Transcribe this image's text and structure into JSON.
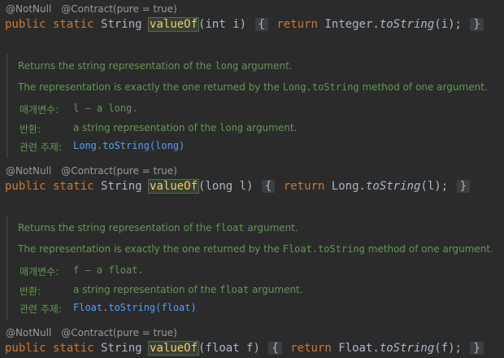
{
  "blocks": [
    {
      "annotations": [
        "@NotNull",
        "@Contract(pure = true)"
      ],
      "code": {
        "modifiers": "public static",
        "return_type": "String",
        "method": "valueOf",
        "param": "(int i)",
        "fold_open": "{",
        "body_kw": "return",
        "body_call": "Integer.",
        "body_method": "toString",
        "body_args": "(i);",
        "fold_close": "}"
      }
    },
    {
      "doc": {
        "line1_pre": "Returns the string representation of the ",
        "line1_code": "long",
        "line1_post": " argument.",
        "line2_pre": "The representation is exactly the one returned by the ",
        "line2_code": "Long.toString",
        "line2_post": " method of one argument.",
        "param_label": "매개변수:",
        "param_value": "l – a long.",
        "return_label": "반환:",
        "return_pre": "a string representation of the ",
        "return_code": "long",
        "return_post": " argument.",
        "see_label": "관련 주제:",
        "see_link": "Long.toString(long)"
      },
      "annotations": [
        "@NotNull",
        "@Contract(pure = true)"
      ],
      "code": {
        "modifiers": "public static",
        "return_type": "String",
        "method": "valueOf",
        "param": "(long l)",
        "fold_open": "{",
        "body_kw": "return",
        "body_call": "Long.",
        "body_method": "toString",
        "body_args": "(l);",
        "fold_close": "}"
      }
    },
    {
      "doc": {
        "line1_pre": "Returns the string representation of the ",
        "line1_code": "float",
        "line1_post": " argument.",
        "line2_pre": "The representation is exactly the one returned by the ",
        "line2_code": "Float.toString",
        "line2_post": " method of one argument.",
        "param_label": "매개변수:",
        "param_value": "f – a float.",
        "return_label": "반환:",
        "return_pre": "a string representation of the ",
        "return_code": "float",
        "return_post": " argument.",
        "see_label": "관련 주제:",
        "see_link": "Float.toString(float)"
      },
      "annotations": [
        "@NotNull",
        "@Contract(pure = true)"
      ],
      "code": {
        "modifiers": "public static",
        "return_type": "String",
        "method": "valueOf",
        "param": "(float f)",
        "fold_open": "{",
        "body_kw": "return",
        "body_call": "Float.",
        "body_method": "toString",
        "body_args": "(f);",
        "fold_close": "}"
      }
    }
  ]
}
